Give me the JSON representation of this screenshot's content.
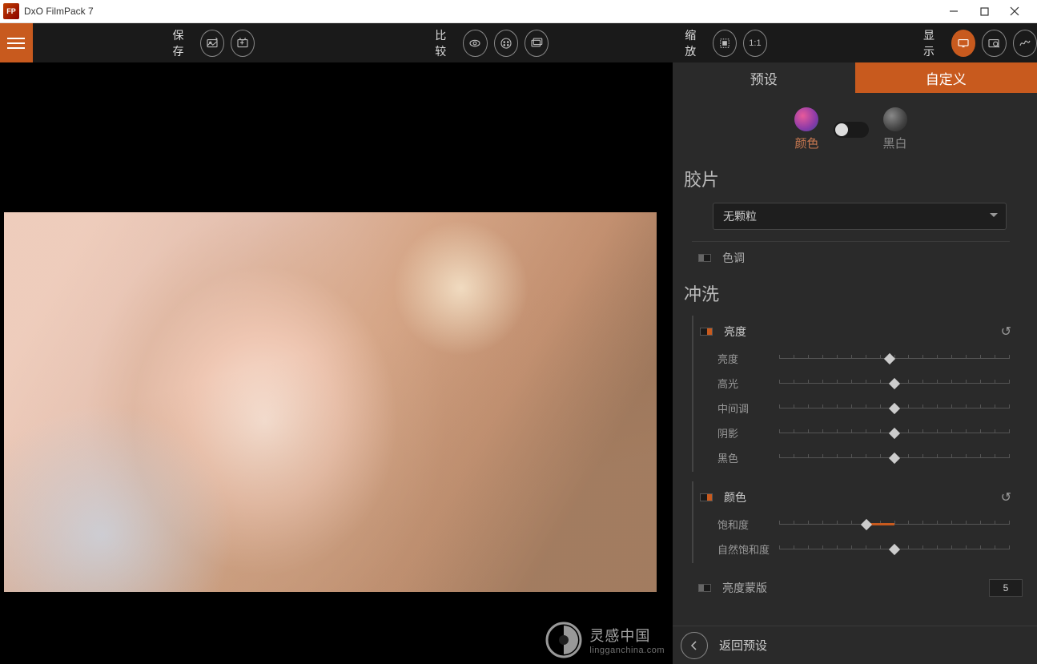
{
  "titlebar": {
    "app_name": "DxO FilmPack 7",
    "app_icon_text": "FP"
  },
  "toolbar": {
    "save_label": "保存",
    "compare_label": "比较",
    "zoom_label": "缩放",
    "zoom_ratio": "1:1",
    "display_label": "显示"
  },
  "tabs": {
    "preset": "预设",
    "custom": "自定义"
  },
  "mode": {
    "color": "颜色",
    "bw": "黑白"
  },
  "sections": {
    "film": "胶片",
    "grain_select": "无颗粒",
    "tone": "色调",
    "develop": "冲洗"
  },
  "brightness": {
    "title": "亮度",
    "sliders": {
      "brightness": "亮度",
      "highlights": "高光",
      "midtones": "中间调",
      "shadows": "阴影",
      "blacks": "黑色"
    }
  },
  "color_group": {
    "title": "颜色",
    "sliders": {
      "saturation": "饱和度",
      "vibrance": "自然饱和度"
    }
  },
  "mask": {
    "title": "亮度蒙版",
    "value": "5"
  },
  "footer": {
    "back": "返回预设"
  },
  "watermark": {
    "cn": "灵感中国",
    "en": "lingganchina.com"
  }
}
